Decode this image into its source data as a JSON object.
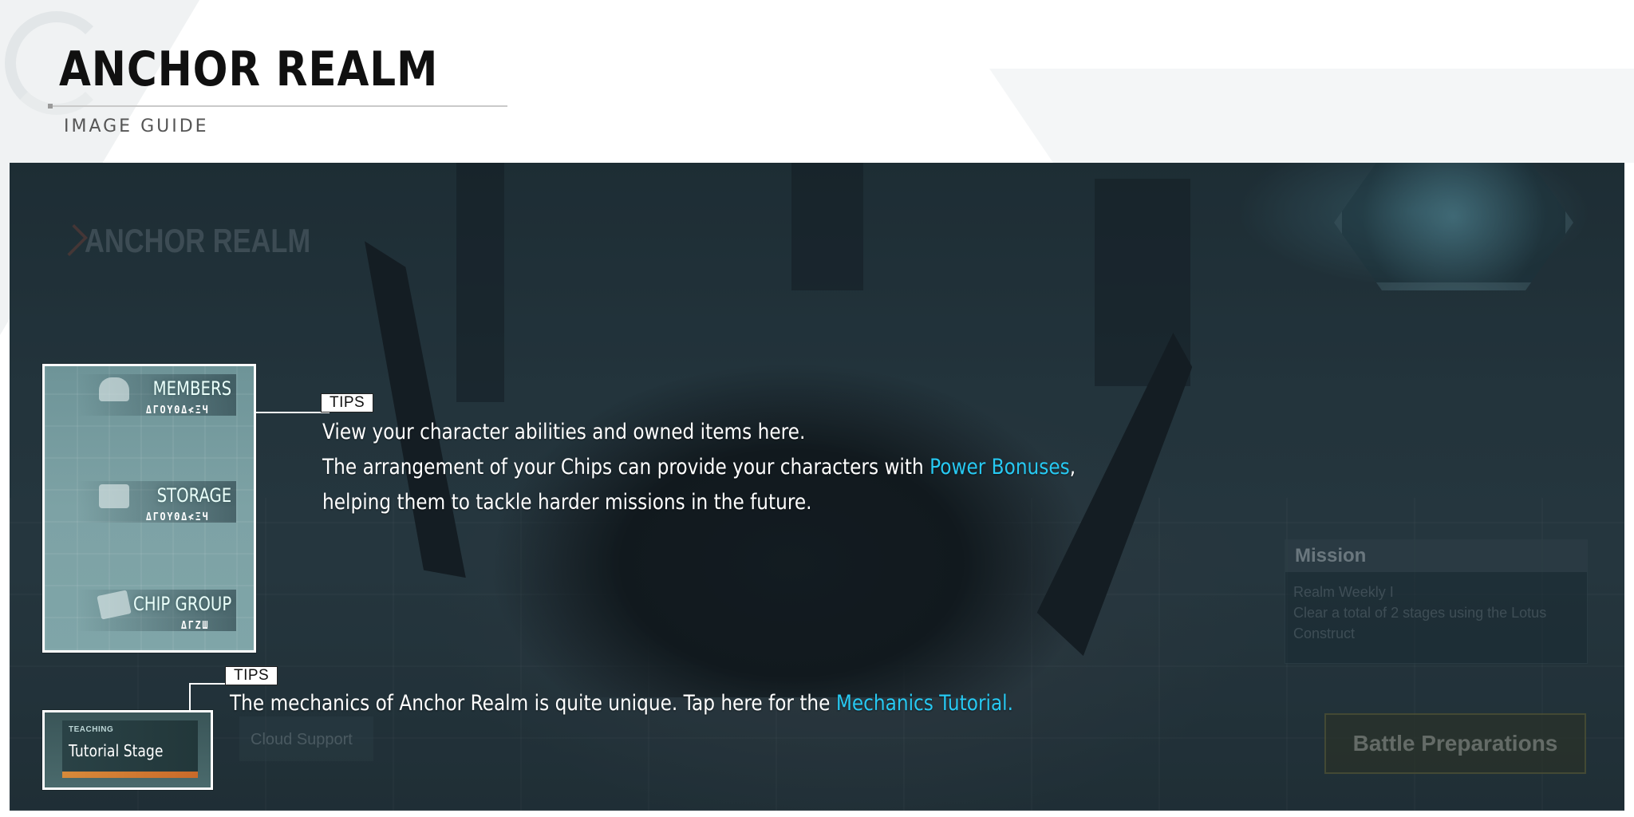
{
  "header": {
    "title": "ANCHOR REALM",
    "subtitle": "IMAGE GUIDE"
  },
  "game_ui": {
    "realm_title": "ANCHOR REALM",
    "mission": {
      "title": "Mission",
      "lines": [
        "Realm Weekly I",
        "Clear a total of 2 stages using the Lotus",
        "Construct"
      ]
    },
    "battle_button": "Battle Preparations",
    "cloud_support": "Cloud Support"
  },
  "menu": {
    "items": [
      {
        "label": "MEMBERS",
        "glyph": "ΔΓΟΥΘΔ≮ΞЧ",
        "icon": "members-icon"
      },
      {
        "label": "STORAGE",
        "glyph": "ΔΓΟΥΘΔ≮ΞЧ",
        "icon": "storage-icon"
      },
      {
        "label": "CHIP GROUP",
        "glyph": "ΔΓΖШ",
        "icon": "chip-group-icon"
      }
    ]
  },
  "tutorial_card": {
    "tag": "TEACHING",
    "label": "Tutorial Stage"
  },
  "tips": [
    {
      "tag": "TIPS",
      "line1": "View your character abilities and owned items here.",
      "line2_pre": "The arrangement of your Chips can provide your characters with ",
      "line2_highlight": "Power Bonuses",
      "line2_post": ",",
      "line3": "helping them to tackle harder missions in the future."
    },
    {
      "tag": "TIPS",
      "text_pre": "The mechanics of Anchor Realm is quite unique. Tap here for the ",
      "text_highlight": "Mechanics Tutorial."
    }
  ],
  "colors": {
    "highlight": "#27c9f2",
    "title": "#101010"
  }
}
